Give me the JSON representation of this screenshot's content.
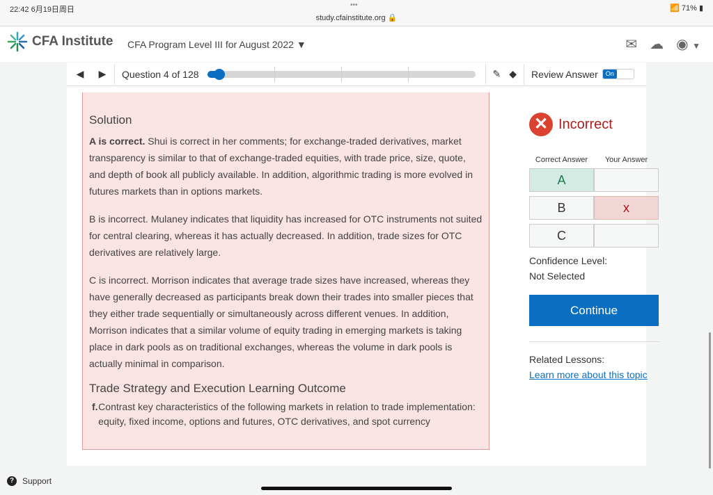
{
  "status": {
    "time": "22:42  6月19日周日",
    "url": "study.cfainstitute.org 🔒",
    "battery": "71%"
  },
  "header": {
    "logo": "CFA Institute",
    "program": "CFA Program Level III for August 2022"
  },
  "toolbar": {
    "question": "Question 4 of 128",
    "progress_percent": 3,
    "review_label": "Review Answer",
    "toggle": "On"
  },
  "solution": {
    "title": "Solution",
    "a_bold": "A is correct.",
    "a_text": " Shui is correct in her comments; for exchange-traded derivatives, market transparency is similar to that of exchange-traded equities, with trade price, size, quote, and depth of book all publicly available. In addition, algorithmic trading is more evolved in futures markets than in options markets.",
    "b_text": "B is incorrect. Mulaney indicates that liquidity has increased for OTC instruments not suited for central clearing, whereas it has actually decreased. In addition, trade sizes for OTC derivatives are relatively large.",
    "c_text": "C is incorrect. Morrison indicates that average trade sizes have increased, whereas they have generally decreased as participants break down their trades into smaller pieces that they either trade sequentially or simultaneously across different venues. In addition, Morrison indicates that a similar volume of equity trading in emerging markets is taking place in dark pools as on traditional exchanges, whereas the volume in dark pools is actually minimal in comparison.",
    "lo_title": "Trade Strategy and Execution Learning Outcome",
    "lo_letter": "f.",
    "lo_text": "Contrast key characteristics of the following markets in relation to trade implementation: equity, fixed income, options and futures, OTC derivatives, and spot currency"
  },
  "side": {
    "result": "Incorrect",
    "correct_header": "Correct Answer",
    "your_header": "Your Answer",
    "rows": [
      {
        "option": "A",
        "yours": ""
      },
      {
        "option": "B",
        "yours": "x"
      },
      {
        "option": "C",
        "yours": ""
      }
    ],
    "confidence_label": "Confidence Level:",
    "confidence_value": "Not Selected",
    "continue": "Continue",
    "related_label": "Related Lessons:",
    "related_link": "Learn more about this topic"
  },
  "support": "Support",
  "colors": {
    "accent": "#0a6fc2",
    "incorrect": "#d9432f",
    "solution_bg": "#f9e3e3"
  }
}
